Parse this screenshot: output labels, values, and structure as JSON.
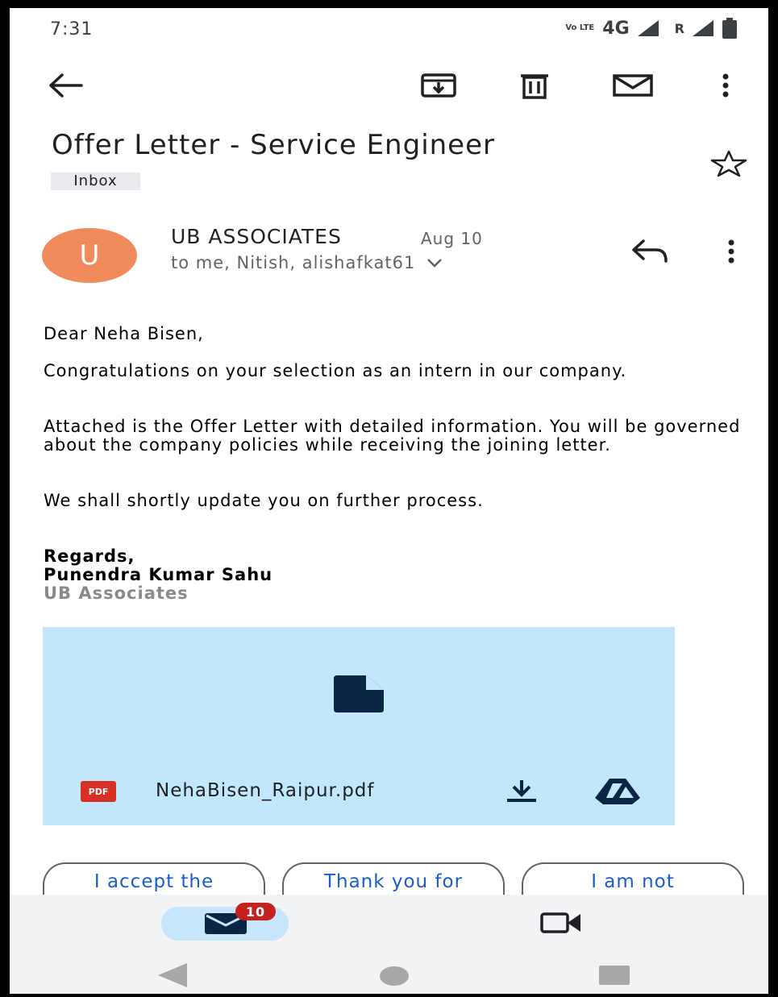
{
  "status_bar": {
    "time": "7:31",
    "volte": "Vo LTE",
    "network": "4G",
    "roaming": "R"
  },
  "toolbar": {
    "back": "arrow-left-icon",
    "archive": "archive-icon",
    "delete": "trash-icon",
    "mark_unread": "mail-icon",
    "more": "more-vert-icon"
  },
  "email": {
    "subject": "Offer Letter - Service Engineer",
    "label": "Inbox",
    "sender_initial": "U",
    "sender_name": "UB ASSOCIATES",
    "date": "Aug 10",
    "recipients": "to me, Nitish, alishafkat61",
    "greeting": "Dear Neha Bisen,",
    "paragraph1": "Congratulations on your selection as an intern in our company.",
    "paragraph2": "Attached is the Offer Letter with detailed information. You will be governed about the company policies while receiving the joining letter.",
    "paragraph3": "We shall shortly update you on further process.",
    "signature": {
      "regards": "Regards,",
      "name": "Punendra Kumar Sahu",
      "company": "UB Associates"
    }
  },
  "attachment": {
    "type_label": "PDF",
    "filename": "NehaBisen_Raipur.pdf"
  },
  "smart_replies": [
    "I accept the",
    "Thank you for",
    "I am not"
  ],
  "bottom_nav": {
    "mail_badge": "10"
  },
  "colors": {
    "avatar": "#f28b5c",
    "attachment_bg": "#c3e7fa",
    "link": "#1a5cc8",
    "badge": "#c5221f"
  }
}
